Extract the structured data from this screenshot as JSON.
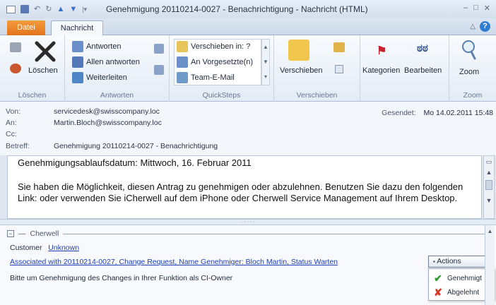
{
  "window": {
    "title": "Genehmigung 20110214-0027 - Benachrichtigung  -  Nachricht (HTML)",
    "controls": [
      "–",
      "□",
      "✕"
    ]
  },
  "tabs": {
    "file": "Datei",
    "message": "Nachricht"
  },
  "ribbon": {
    "loeschen": {
      "button": "Löschen",
      "label": "Löschen"
    },
    "antworten": {
      "reply": "Antworten",
      "reply_all": "Allen antworten",
      "forward": "Weiterleiten",
      "label": "Antworten"
    },
    "quicksteps": {
      "move_to": "Verschieben in: ?",
      "to_manager": "An Vorgesetzte(n)",
      "team_mail": "Team-E-Mail",
      "label": "QuickSteps"
    },
    "verschieben": {
      "button": "Verschieben",
      "label": "Verschieben"
    },
    "tags": {
      "categories": "Kategorien"
    },
    "editing": {
      "button": "Bearbeiten"
    },
    "zoom": {
      "button": "Zoom",
      "label": "Zoom"
    }
  },
  "header": {
    "from_label": "Von:",
    "from": "servicedesk@swisscompany.loc",
    "to_label": "An:",
    "to": "Martin.Bloch@swisscompany.loc",
    "cc_label": "Cc:",
    "cc": "",
    "subject_label": "Betreff:",
    "subject": "Genehmigung 20110214-0027 - Benachrichtigung",
    "sent_label": "Gesendet:",
    "sent": "Mo 14.02.2011 15:48"
  },
  "body": {
    "line1": "Genehmigungsablaufsdatum: Mittwoch, 16. Februar 2011",
    "line2": "Sie haben die Möglichkeit, diesen Antrag zu genehmigen oder abzulehnen. Benutzen Sie dazu den folgenden",
    "line3": "Link:  oder verwenden Sie iCherwell auf dem iPhone oder Cherwell Service Management auf Ihrem Desktop."
  },
  "cherwell": {
    "section": "Cherwell",
    "customer_label": "Customer",
    "customer_link": "Unknown",
    "associated": "Associated with 20110214-0027, Change Request, Name Genehmiger: Bloch Martin, Status Warten",
    "note": "Bitte um Genehmigung des Changes in Ihrer Funktion als CI-Owner",
    "actions_label": "Actions",
    "menu": [
      {
        "label": "Genehmigt",
        "icon": "check-icon",
        "color": "#2e9a2e"
      },
      {
        "label": "Abgelehnt",
        "icon": "x-icon",
        "color": "#d6382a"
      }
    ]
  },
  "colors": {
    "file_tab": "#e98126",
    "link": "#1f3fb3",
    "help": "#2f7cd3"
  }
}
